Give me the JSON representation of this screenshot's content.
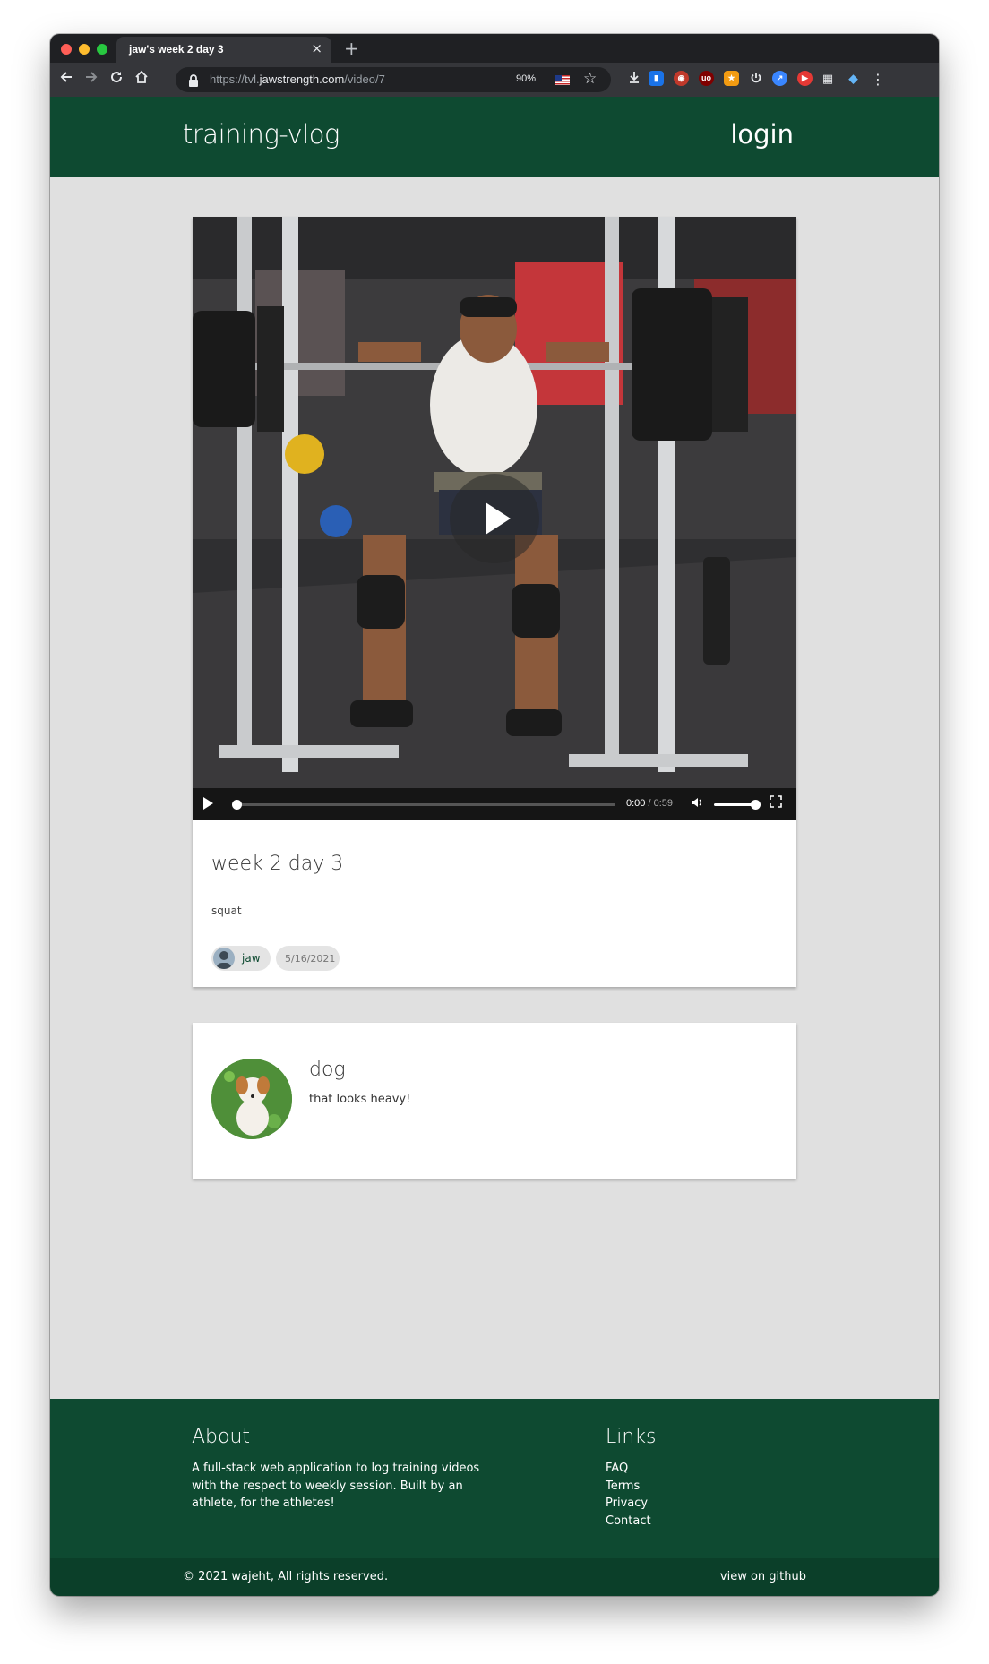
{
  "browser": {
    "tab_title": "jaw's week 2 day 3",
    "tab_close": "×",
    "new_tab": "+",
    "url_prefix": "https://tvl.",
    "url_host": "jawstrength.com",
    "url_path": "/video/7",
    "zoom": "90%"
  },
  "header": {
    "brand": "training-vlog",
    "login": "login"
  },
  "video": {
    "current_time": "0:00",
    "separator": " / ",
    "duration": "0:59",
    "progress_fraction": 0.0,
    "volume_fraction": 1.0,
    "title": "week 2 day 3",
    "description": "squat",
    "author": "jaw",
    "date": "5/16/2021"
  },
  "comment": {
    "author": "dog",
    "text": "that looks heavy!"
  },
  "footer": {
    "about_heading": "About",
    "about_text": "A full-stack web application to log training videos with the respect to weekly session. Built by an athlete, for the athletes!",
    "links_heading": "Links",
    "links": [
      "FAQ",
      "Terms",
      "Privacy",
      "Contact"
    ],
    "copyright": "© 2021 wajeht, All rights reserved.",
    "github": "view on github"
  },
  "colors": {
    "brand_green": "#0e4a31",
    "page_bg": "#e0e0e0"
  },
  "icons": [
    "back-arrow-icon",
    "forward-arrow-icon",
    "reload-icon",
    "home-icon",
    "lock-icon",
    "star-icon",
    "download-icon",
    "volume-icon",
    "fullscreen-icon",
    "play-icon"
  ]
}
